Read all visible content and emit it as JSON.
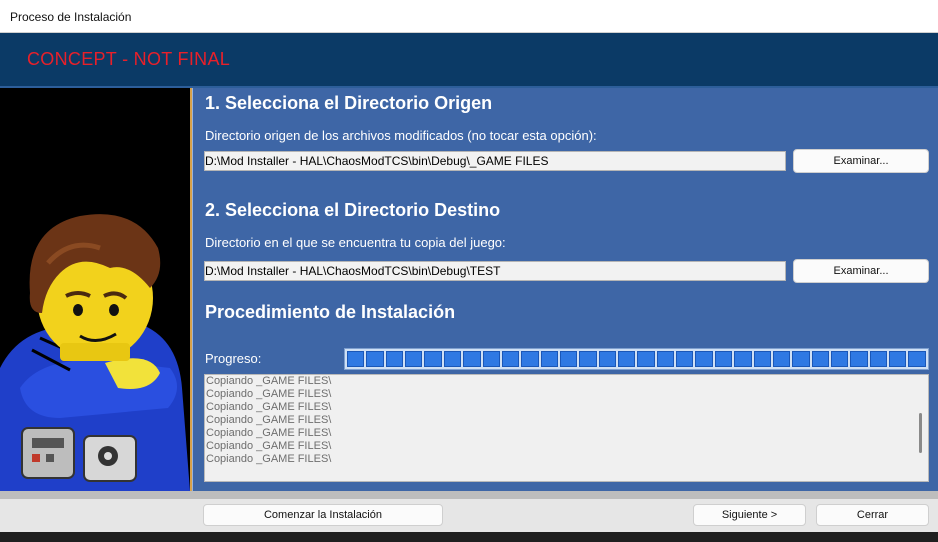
{
  "window": {
    "title": "Proceso de Instalación"
  },
  "banner": {
    "text": "CONCEPT - NOT FINAL",
    "text_color": "#e8202a",
    "background": "#0b3a66"
  },
  "source": {
    "heading": "1. Selecciona el Directorio Origen",
    "description": "Directorio origen de los archivos modificados (no tocar esta opción):",
    "path": "D:\\Mod Installer - HAL\\ChaosModTCS\\bin\\Debug\\_GAME FILES",
    "browse_label": "Examinar..."
  },
  "destination": {
    "heading": "2. Selecciona el Directorio Destino",
    "description": "Directorio en el que se encuentra tu copia del juego:",
    "path": "D:\\Mod Installer - HAL\\ChaosModTCS\\bin\\Debug\\TEST",
    "browse_label": "Examinar..."
  },
  "procedure": {
    "heading": "Procedimiento de Instalación",
    "progress_label": "Progreso:",
    "progress": 1.0,
    "log": [
      "Copiando _GAME FILES\\",
      "Copiando _GAME FILES\\",
      "Copiando _GAME FILES\\",
      "Copiando _GAME FILES\\",
      "Copiando _GAME FILES\\",
      "Copiando _GAME FILES\\",
      "Copiando _GAME FILES\\"
    ]
  },
  "footer": {
    "start_label": "Comenzar la Instalación",
    "next_label": "Siguiente >",
    "close_label": "Cerrar"
  },
  "colors": {
    "panel": "#3e66a6",
    "progress_fill": "#2f79e3"
  },
  "icons": {
    "character": "lego-minifigure-icon"
  }
}
